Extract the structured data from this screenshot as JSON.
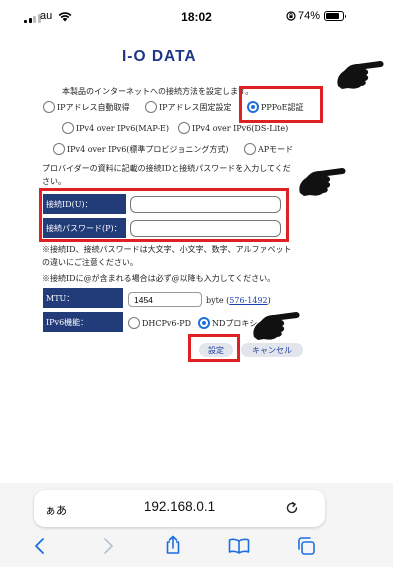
{
  "status_bar": {
    "carrier": "au",
    "time": "18:02",
    "battery": "74%"
  },
  "page": {
    "logo": "I-O DATA",
    "intro": "本製品のインターネットへの接続方法を設定します。",
    "connection_options": [
      {
        "label": "IPアドレス自動取得",
        "selected": false
      },
      {
        "label": "IPアドレス固定設定",
        "selected": false
      },
      {
        "label": "PPPoE認証",
        "selected": true
      },
      {
        "label": "IPv4 over IPv6(MAP-E)",
        "selected": false
      },
      {
        "label": "IPv4 over IPv6(DS-Lite)",
        "selected": false
      },
      {
        "label": "IPv4 over IPv6(標準プロビジョニング方式)",
        "selected": false
      },
      {
        "label": "APモード",
        "selected": false
      }
    ],
    "provider_note_1": "プロバイダーの資料に記載の接続IDと接続パスワードを入力してくだ",
    "provider_note_2": "さい。",
    "fields": {
      "id_label": "接続ID(U)：",
      "password_label": "接続パスワード(P)："
    },
    "note_case_1": "※接続ID、接続パスワードは大文字、小文字、数字、アルファベット",
    "note_case_2": "の違いにご注意ください。",
    "note_at": "※接続IDに@が含まれる場合は必ず@以降も入力してください。",
    "mtu": {
      "label": "MTU：",
      "value": "1454",
      "unit": "byte (",
      "range": "576-1492",
      "close": ")"
    },
    "ipv6": {
      "label": "IPv6機能：",
      "options": [
        {
          "label": "DHCPv6-PD",
          "selected": false
        },
        {
          "label": "NDプロキシ",
          "selected": true
        }
      ]
    },
    "buttons": {
      "apply": "設定",
      "cancel": "キャンセル"
    }
  },
  "browser": {
    "text_size": "ぁあ",
    "address": "192.168.0.1"
  },
  "colors": {
    "brand": "#1f3687",
    "label_bg": "#223b79",
    "highlight": "#e02121",
    "radio_selected": "#1d6fe0"
  }
}
